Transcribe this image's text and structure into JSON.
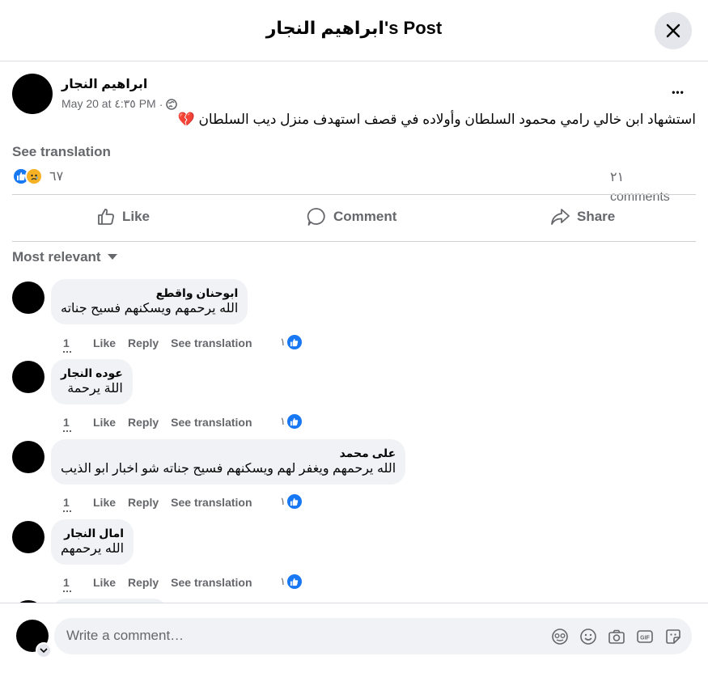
{
  "header": {
    "title": "ابراهيم النجار's Post"
  },
  "post": {
    "author": "ابراهيم النجار",
    "time": "May 20 at ٤:٣٥ PM",
    "privacy_dot": "·",
    "text": "استشهاد ابن خالي رامي محمود السلطان وأولاده في قصف استهدف منزل ديب السلطان",
    "emoji": "💔",
    "see_translation": "See translation",
    "reaction_count": "٦٧",
    "comments_count": "٢١ comments",
    "more": "•••"
  },
  "actions": {
    "like": "Like",
    "comment": "Comment",
    "share": "Share"
  },
  "sort": {
    "label": "Most relevant"
  },
  "comments": [
    {
      "author": "ابوحنان واقطع",
      "text": "الله يرحمهم ويسكنهم فسيح جناته",
      "time": "1",
      "like": "Like",
      "reply": "Reply",
      "translate": "See translation",
      "likes": "١"
    },
    {
      "author": "عوده النجار",
      "text": "اللة يرحمة",
      "time": "1",
      "like": "Like",
      "reply": "Reply",
      "translate": "See translation",
      "likes": "١"
    },
    {
      "author": "على محمد",
      "text": "الله يرحمهم ويغفر لهم ويسكنهم فسيح جناته شو اخبار ابو الذيب",
      "time": "1",
      "like": "Like",
      "reply": "Reply",
      "translate": "See translation",
      "likes": "١"
    },
    {
      "author": "امال النجار",
      "text": "الله يرحمهم",
      "time": "1",
      "like": "Like",
      "reply": "Reply",
      "translate": "See translation",
      "likes": "١"
    }
  ],
  "composer": {
    "placeholder": "Write a comment…"
  },
  "colors": {
    "accent": "#1877f2",
    "muted": "#65676b",
    "bubble": "#f0f2f5",
    "sad": "#f7b125"
  }
}
